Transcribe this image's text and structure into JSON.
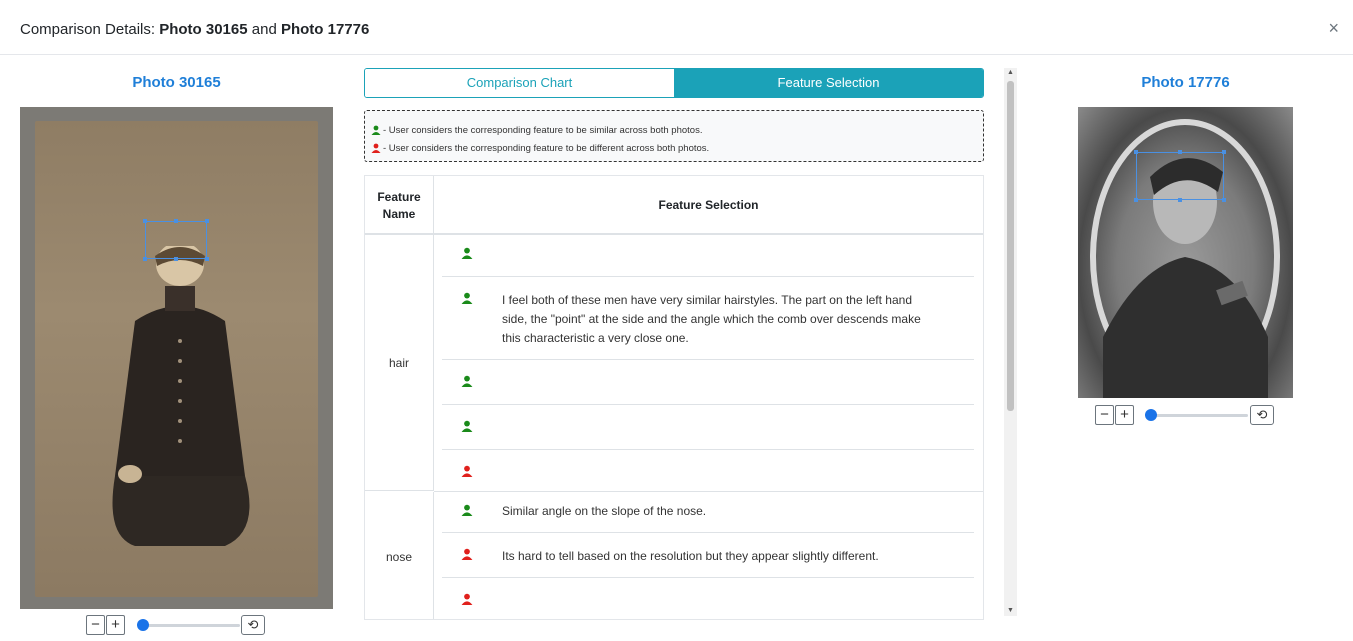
{
  "header": {
    "prefix": "Comparison Details: ",
    "photo_a": "Photo 30165",
    "joiner": " and ",
    "photo_b": "Photo 17776",
    "close": "×"
  },
  "left_photo": {
    "title": "Photo 30165",
    "zoom_out": "−",
    "zoom_in": "+",
    "reset": "⟲",
    "zoom_level": 0
  },
  "right_photo": {
    "title": "Photo 17776",
    "zoom_out": "−",
    "zoom_in": "+",
    "reset": "⟲",
    "zoom_level": 0
  },
  "tabs": {
    "comparison_chart": "Comparison Chart",
    "feature_selection": "Feature Selection",
    "active": "feature_selection"
  },
  "legend": {
    "similar": " - User considers the corresponding feature to be similar across both photos.",
    "different": " - User considers the corresponding feature to be different across both photos."
  },
  "table": {
    "col_feature": "Feature Name",
    "col_selection": "Feature Selection",
    "groups": [
      {
        "feature": "hair",
        "rows": [
          {
            "verdict": "similar",
            "comment": ""
          },
          {
            "verdict": "similar",
            "comment": "I feel both of these men have very similar hairstyles. The part on the left hand side, the \"point\" at the side and the angle which the comb over descends make this characteristic a very close one."
          },
          {
            "verdict": "similar",
            "comment": ""
          },
          {
            "verdict": "similar",
            "comment": ""
          },
          {
            "verdict": "different",
            "comment": ""
          }
        ]
      },
      {
        "feature": "nose",
        "rows": [
          {
            "verdict": "similar",
            "comment": "Similar angle on the slope of the nose."
          },
          {
            "verdict": "different",
            "comment": "Its hard to tell based on the resolution but they appear slightly different."
          },
          {
            "verdict": "different",
            "comment": ""
          }
        ]
      }
    ]
  },
  "colors": {
    "similar": "#1a8a1a",
    "different": "#e0201c",
    "accent": "#1ba2b8",
    "photo_title": "#1f7fd8"
  },
  "icons": {
    "similar": "user-green-icon",
    "different": "user-red-icon"
  }
}
